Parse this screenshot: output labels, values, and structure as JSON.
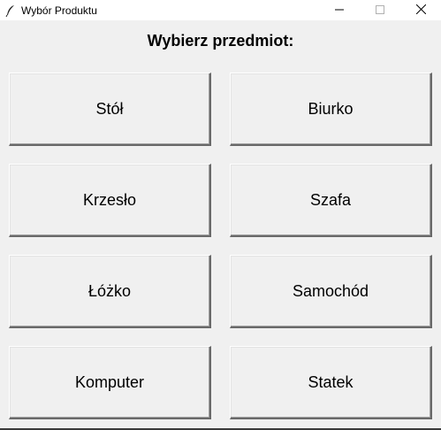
{
  "window": {
    "title": "Wybór Produktu",
    "controls": {
      "minimize": "minimize-icon",
      "maximize": "maximize-icon",
      "close": "close-icon"
    }
  },
  "main": {
    "heading": "Wybierz przedmiot:",
    "buttons": [
      "Stół",
      "Biurko",
      "Krzesło",
      "Szafa",
      "Łóżko",
      "Samochód",
      "Komputer",
      "Statek"
    ]
  },
  "colors": {
    "background": "#f0f0f0",
    "titlebar": "#ffffff",
    "button_face": "#f0f0f0",
    "button_shadow": "#696969",
    "text": "#000000"
  }
}
